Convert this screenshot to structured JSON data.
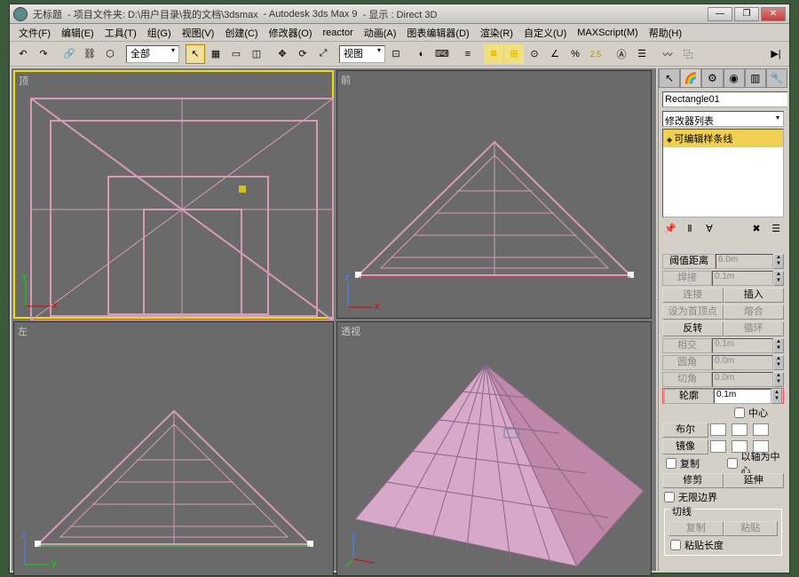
{
  "titlebar": {
    "appicon": "3dsmax-icon",
    "untitled": "无标题",
    "projectfolder_label": "- 项目文件夹: D:\\用户目录\\我的文档\\3dsmax",
    "appname": "- Autodesk 3ds Max 9",
    "display": "- 显示 : Direct 3D"
  },
  "menus": {
    "file": "文件(F)",
    "edit": "编辑(E)",
    "tools": "工具(T)",
    "group": "组(G)",
    "views": "视图(V)",
    "create": "创建(C)",
    "modifiers": "修改器(O)",
    "reactor": "reactor",
    "animation": "动画(A)",
    "grapheditors": "图表编辑器(D)",
    "rendering": "渲染(R)",
    "customize": "自定义(U)",
    "maxscript": "MAXScript(M)",
    "help": "帮助(H)"
  },
  "toolbar": {
    "selfilter": "全部",
    "viewlabel": "视图",
    "spinnerval": "2.5"
  },
  "viewports": {
    "top": "顶",
    "front": "前",
    "left": "左",
    "persp": "透视"
  },
  "cmdpanel": {
    "objname": "Rectangle01",
    "modlist_label": "修改器列表",
    "modstack_item": "可编辑样条线"
  },
  "rollup": {
    "threshold_label": "阈值距离",
    "threshold_val": "6.0m",
    "weld_label": "焊接",
    "weld_val": "0.1m",
    "connect_label": "连接",
    "insert_label": "插入",
    "makefirst_label": "设为首顶点",
    "fuse_label": "熔合",
    "reverse_label": "反转",
    "cycle_label": "循环",
    "crossinsert_label": "相交",
    "crossinsert_val": "0.1m",
    "fillet_label": "圆角",
    "fillet_val": "0.0m",
    "chamfer_label": "切角",
    "chamfer_val": "0.0m",
    "outline_label": "轮廓",
    "outline_val": "0.1m",
    "center_label": "中心",
    "boolean_label": "布尔",
    "mirror_label": "镜像",
    "copy_label": "复制",
    "aboutpivot_label": "以轴为中心",
    "trim_label": "修剪",
    "extend_label": "延伸",
    "infinite_label": "无限边界",
    "tangent_section": "切线",
    "copytangent_label": "复制",
    "pastetangent_label": "粘贴",
    "pastelength_label": "粘贴长度"
  }
}
